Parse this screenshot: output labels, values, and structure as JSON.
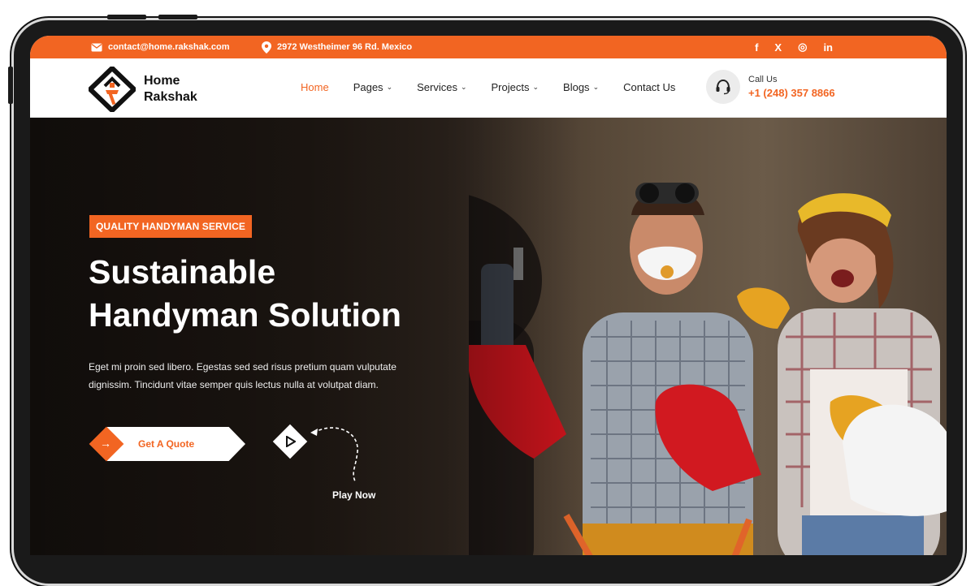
{
  "topbar": {
    "email": "contact@home.rakshak.com",
    "address": "2972 Westheimer 96 Rd. Mexico",
    "social": [
      "f",
      "X",
      "◎",
      "in"
    ]
  },
  "brand": {
    "line1": "Home",
    "line2": "Rakshak"
  },
  "nav": {
    "items": [
      {
        "label": "Home",
        "active": true,
        "dropdown": false
      },
      {
        "label": "Pages",
        "active": false,
        "dropdown": true
      },
      {
        "label": "Services",
        "active": false,
        "dropdown": true
      },
      {
        "label": "Projects",
        "active": false,
        "dropdown": true
      },
      {
        "label": "Blogs",
        "active": false,
        "dropdown": true
      },
      {
        "label": "Contact Us",
        "active": false,
        "dropdown": false
      }
    ],
    "call_label": "Call Us",
    "call_phone": "+1 (248) 357 8866"
  },
  "hero": {
    "badge": "QUALITY HANDYMAN SERVICE",
    "title_line1": "Sustainable",
    "title_line2": "Handyman Solution",
    "desc_line1": "Eget mi proin sed libero. Egestas sed sed risus pretium quam vulputate",
    "desc_line2": "dignissim. Tincidunt vitae semper quis lectus nulla at volutpat diam.",
    "cta_label": "Get A Quote",
    "play_label": "Play Now"
  },
  "colors": {
    "accent": "#f26522",
    "dark": "#241c17"
  }
}
